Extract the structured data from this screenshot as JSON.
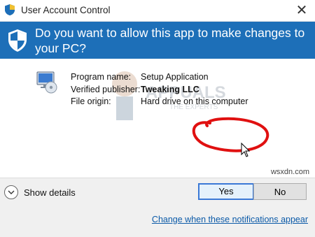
{
  "window": {
    "title": "User Account Control",
    "close_glyph": "✕"
  },
  "banner": {
    "question": "Do you want to allow this app to make changes to your PC?",
    "icon": "shield-icon",
    "color": "#1d6fb8"
  },
  "program": {
    "icon": "setup-program-icon",
    "rows": [
      {
        "label": "Program name:",
        "value": "Setup Application"
      },
      {
        "label": "Verified publisher:",
        "value": "Tweaking LLC"
      },
      {
        "label": "File origin:",
        "value": "Hard drive on this computer"
      }
    ]
  },
  "watermark": {
    "brand": "APPUALS",
    "tagline": "THE EXPERTS",
    "site": "wsxdn.com"
  },
  "footer": {
    "show_details_label": "Show details",
    "yes_label": "Yes",
    "no_label": "No",
    "notifications_link": "Change when these notifications appear"
  },
  "annotation": {
    "highlight_color": "#e01010",
    "target": "yes-button"
  }
}
